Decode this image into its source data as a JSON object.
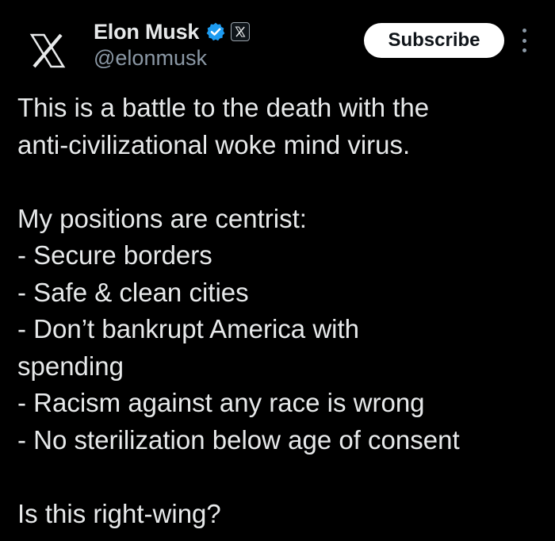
{
  "author": {
    "display_name": "Elon Musk",
    "handle": "@elonmusk",
    "avatar_icon": "x-logo-icon",
    "verified_icon": "verified-badge-icon",
    "affiliation_icon": "x-affiliate-badge-icon"
  },
  "header": {
    "subscribe_label": "Subscribe",
    "more_icon": "more-options-icon"
  },
  "tweet": {
    "paragraph_1": [
      "This is a battle to the death with the",
      "anti-civilizational woke mind virus."
    ],
    "paragraph_2": [
      "My positions are centrist:",
      "- Secure borders",
      "- Safe & clean cities",
      "- Don’t bankrupt America with",
      "spending",
      "- Racism against any race is wrong",
      "- No sterilization below age of consent"
    ],
    "paragraph_3": [
      "Is this right-wing?"
    ]
  },
  "colors": {
    "background": "#000000",
    "text": "#e7e9ea",
    "secondary_text": "#8b98a5",
    "verified_blue": "#1d9bf0",
    "button_bg": "#ffffff"
  }
}
